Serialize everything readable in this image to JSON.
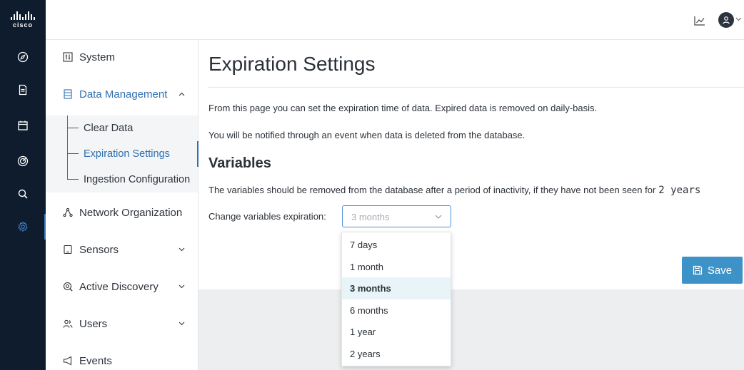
{
  "brand": {
    "logo_text": "cisco"
  },
  "rail": {
    "icons": [
      "compass-icon",
      "document-icon",
      "calendar-icon",
      "target-icon",
      "search-icon",
      "gear-icon"
    ],
    "active_index": 5
  },
  "topbar": {
    "icons": [
      "chart-icon",
      "user-avatar-icon",
      "chevron-down-icon"
    ]
  },
  "sidebar": {
    "system": "System",
    "data_management": "Data Management",
    "clear_data": "Clear Data",
    "expiration_settings": "Expiration Settings",
    "ingestion_configuration": "Ingestion Configuration",
    "network_organization": "Network Organization",
    "sensors": "Sensors",
    "active_discovery": "Active Discovery",
    "users": "Users",
    "events": "Events"
  },
  "main": {
    "title": "Expiration Settings",
    "intro_1": "From this page you can set the expiration time of data. Expired data is removed on daily-basis.",
    "intro_2": "You will be notified through an event when data is deleted from the database.",
    "variables_heading": "Variables",
    "variables_text": "The variables should be removed from the database after a period of inactivity, if they have not been seen for",
    "variables_value": "2 years",
    "change_label": "Change variables expiration:",
    "select_value": "3 months",
    "save_label": "Save"
  },
  "dropdown": {
    "options": [
      "7 days",
      "1 month",
      "3 months",
      "6 months",
      "1 year",
      "2 years"
    ],
    "selected": "3 months"
  },
  "colors": {
    "rail_bg": "#0f1c2e",
    "accent": "#2f6fb2",
    "save_bg": "#3d93c7",
    "selected_option_bg": "#e9f4f8"
  }
}
